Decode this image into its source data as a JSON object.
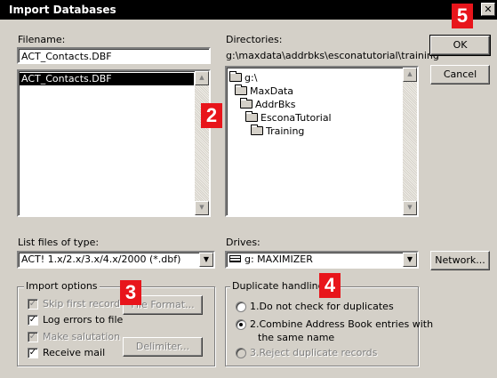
{
  "dialog": {
    "title": "Import Databases",
    "close_glyph": "✕"
  },
  "filename": {
    "label": "Filename:",
    "value": "ACT_Contacts.DBF",
    "files": [
      "ACT_Contacts.DBF"
    ]
  },
  "directories": {
    "label": "Directories:",
    "current_path": "g:\\maxdata\\addrbks\\esconatutorial\\training",
    "tree": [
      {
        "name": "g:\\",
        "depth": 0,
        "open": true
      },
      {
        "name": "MaxData",
        "depth": 1,
        "open": true
      },
      {
        "name": "AddrBks",
        "depth": 2,
        "open": true
      },
      {
        "name": "EsconaTutorial",
        "depth": 3,
        "open": true
      },
      {
        "name": "Training",
        "depth": 4,
        "open": true
      }
    ]
  },
  "buttons": {
    "ok": "OK",
    "cancel": "Cancel",
    "network": "Network...",
    "format": "File Format...",
    "delimiter": "Delimiter..."
  },
  "file_type": {
    "label": "List files of type:",
    "selected": "ACT! 1.x/2.x/3.x/4.x/2000 (*.dbf)"
  },
  "drives": {
    "label": "Drives:",
    "selected": "g: MAXIMIZER"
  },
  "import_options": {
    "title": "Import options",
    "options": [
      {
        "label": "Skip first record",
        "checked": true,
        "enabled": false
      },
      {
        "label": "Log errors to file",
        "checked": true,
        "enabled": true
      },
      {
        "label": "Make salutation",
        "checked": true,
        "enabled": false
      },
      {
        "label": "Receive mail",
        "checked": true,
        "enabled": true
      }
    ]
  },
  "duplicate_handling": {
    "title": "Duplicate handling",
    "options": [
      {
        "label": "1.Do not check for duplicates",
        "selected": false,
        "enabled": true
      },
      {
        "label": "2.Combine Address Book entries with",
        "label_line2": "the same name",
        "selected": true,
        "enabled": true
      },
      {
        "label": "3.Reject duplicate records",
        "selected": false,
        "enabled": false
      }
    ]
  },
  "callouts": [
    "2",
    "3",
    "4",
    "5"
  ],
  "colors": {
    "callout": "#e8151b",
    "dialog_bg": "#d4d0c8",
    "titlebar": "#000000"
  }
}
